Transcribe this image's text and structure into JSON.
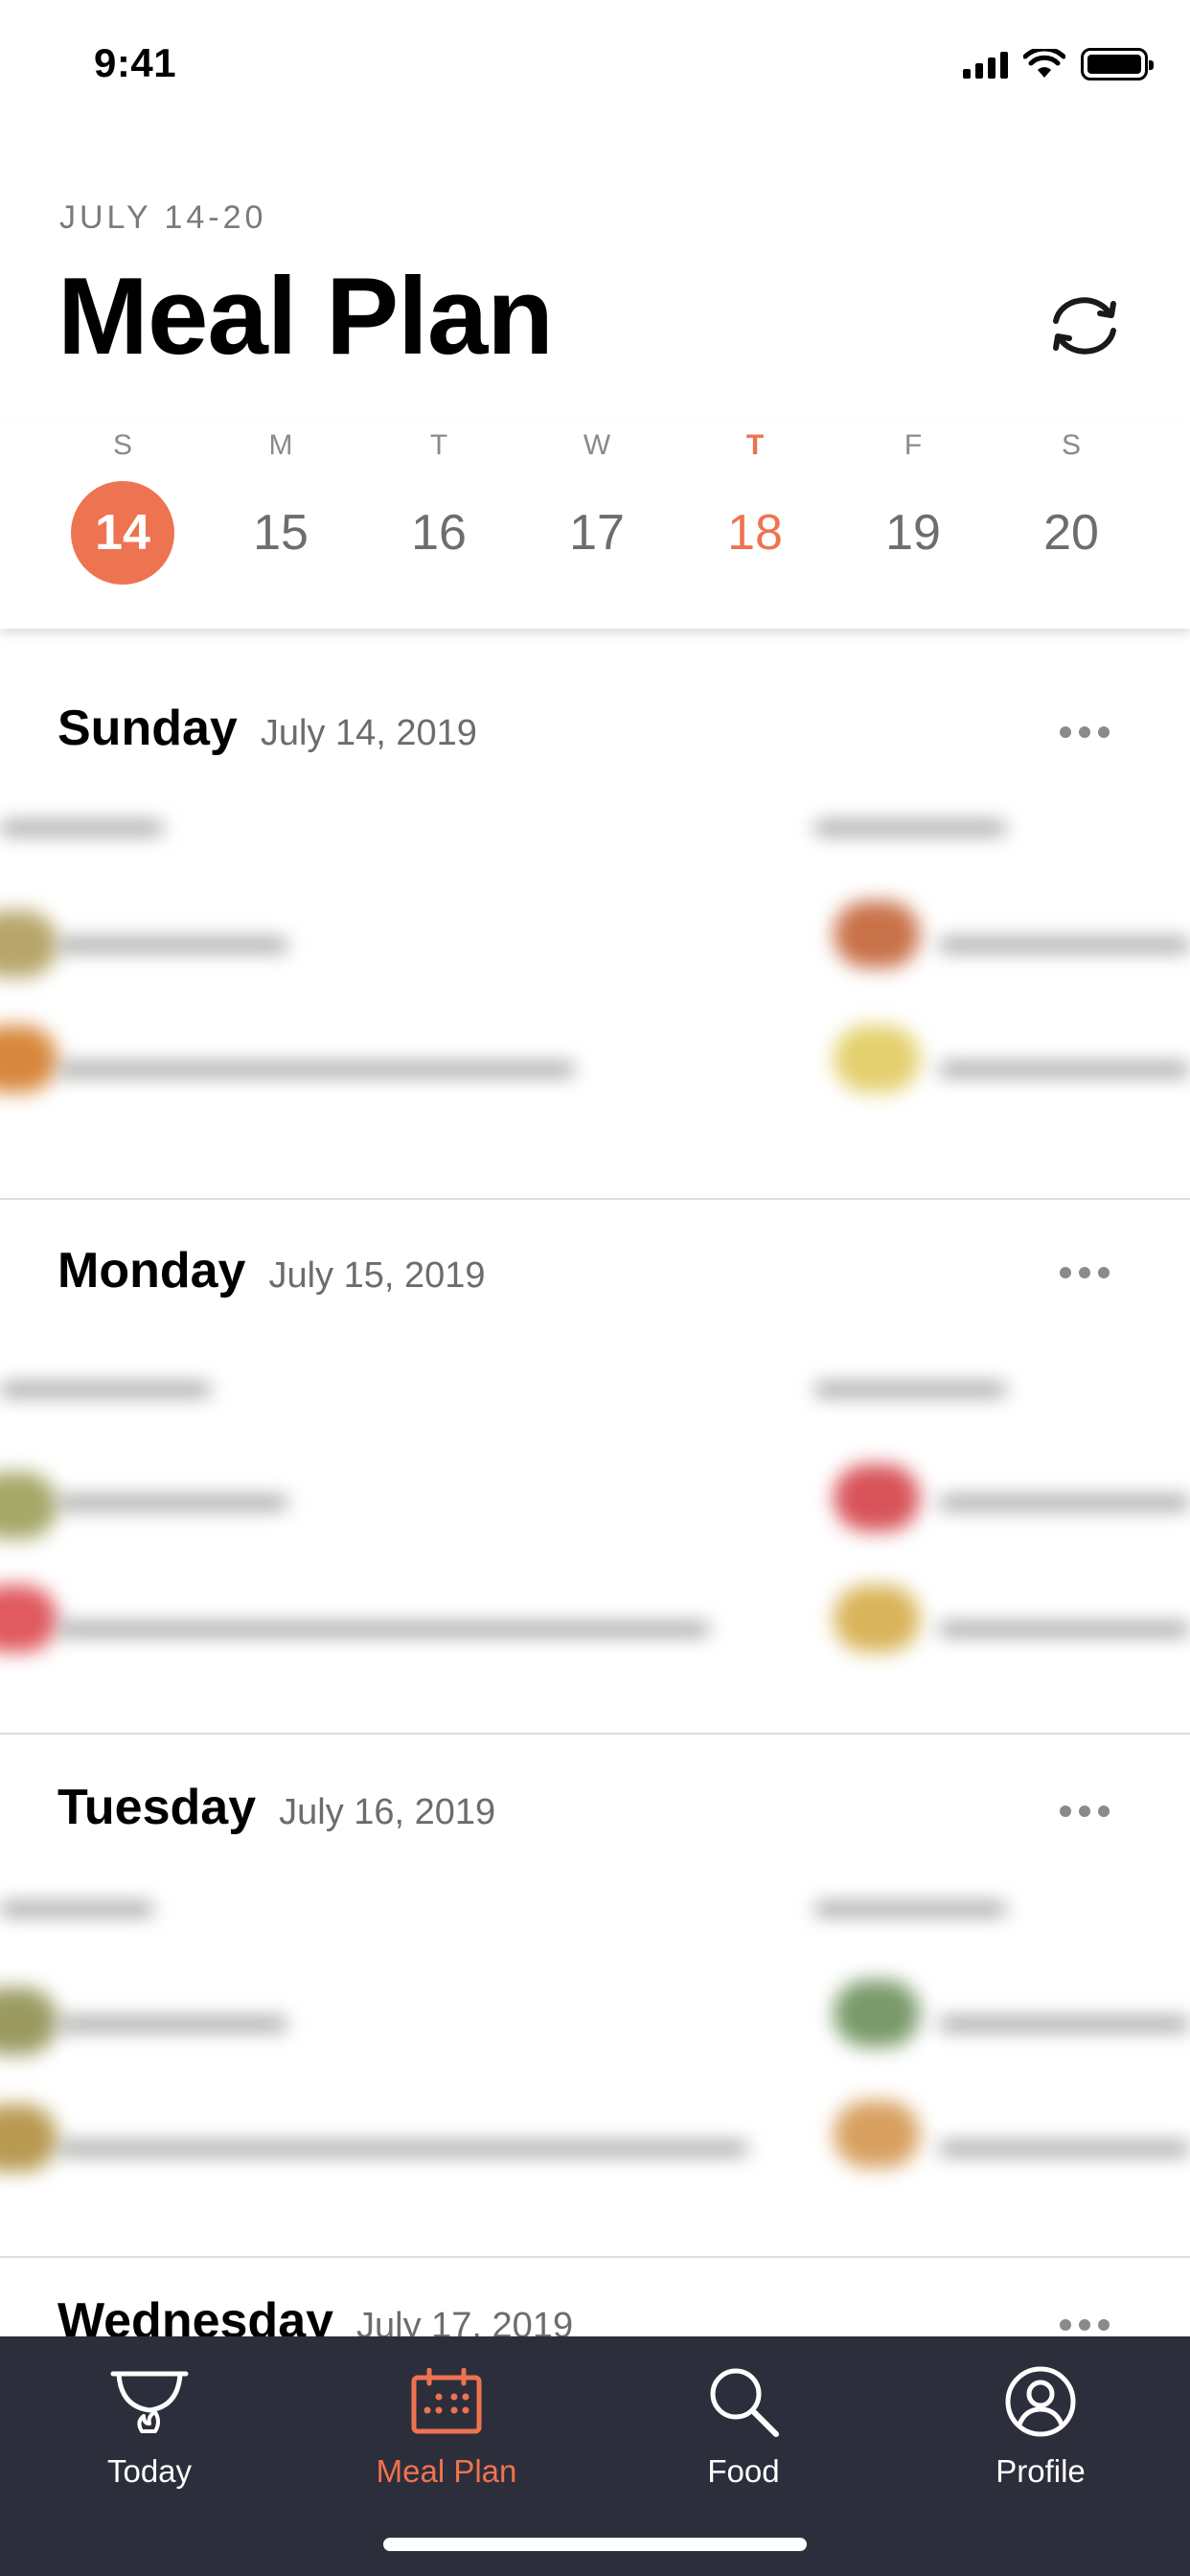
{
  "status_bar": {
    "time": "9:41"
  },
  "header": {
    "range": "JULY 14-20",
    "title": "Meal Plan"
  },
  "week": [
    {
      "dow": "S",
      "num": "14",
      "state": "selected"
    },
    {
      "dow": "M",
      "num": "15",
      "state": ""
    },
    {
      "dow": "T",
      "num": "16",
      "state": ""
    },
    {
      "dow": "W",
      "num": "17",
      "state": ""
    },
    {
      "dow": "T",
      "num": "18",
      "state": "today"
    },
    {
      "dow": "F",
      "num": "19",
      "state": ""
    },
    {
      "dow": "S",
      "num": "20",
      "state": ""
    }
  ],
  "days": [
    {
      "name": "Sunday",
      "date": "July 14, 2019"
    },
    {
      "name": "Monday",
      "date": "July 15, 2019"
    },
    {
      "name": "Tuesday",
      "date": "July 16, 2019"
    },
    {
      "name": "Wednesday",
      "date": "July 17, 2019"
    }
  ],
  "tabs": [
    {
      "label": "Today",
      "icon": "bowl-icon"
    },
    {
      "label": "Meal Plan",
      "icon": "calendar-icon"
    },
    {
      "label": "Food",
      "icon": "search-icon"
    },
    {
      "label": "Profile",
      "icon": "profile-icon"
    }
  ],
  "colors": {
    "accent": "#ee7350",
    "tabbar": "#2d2e3b"
  }
}
